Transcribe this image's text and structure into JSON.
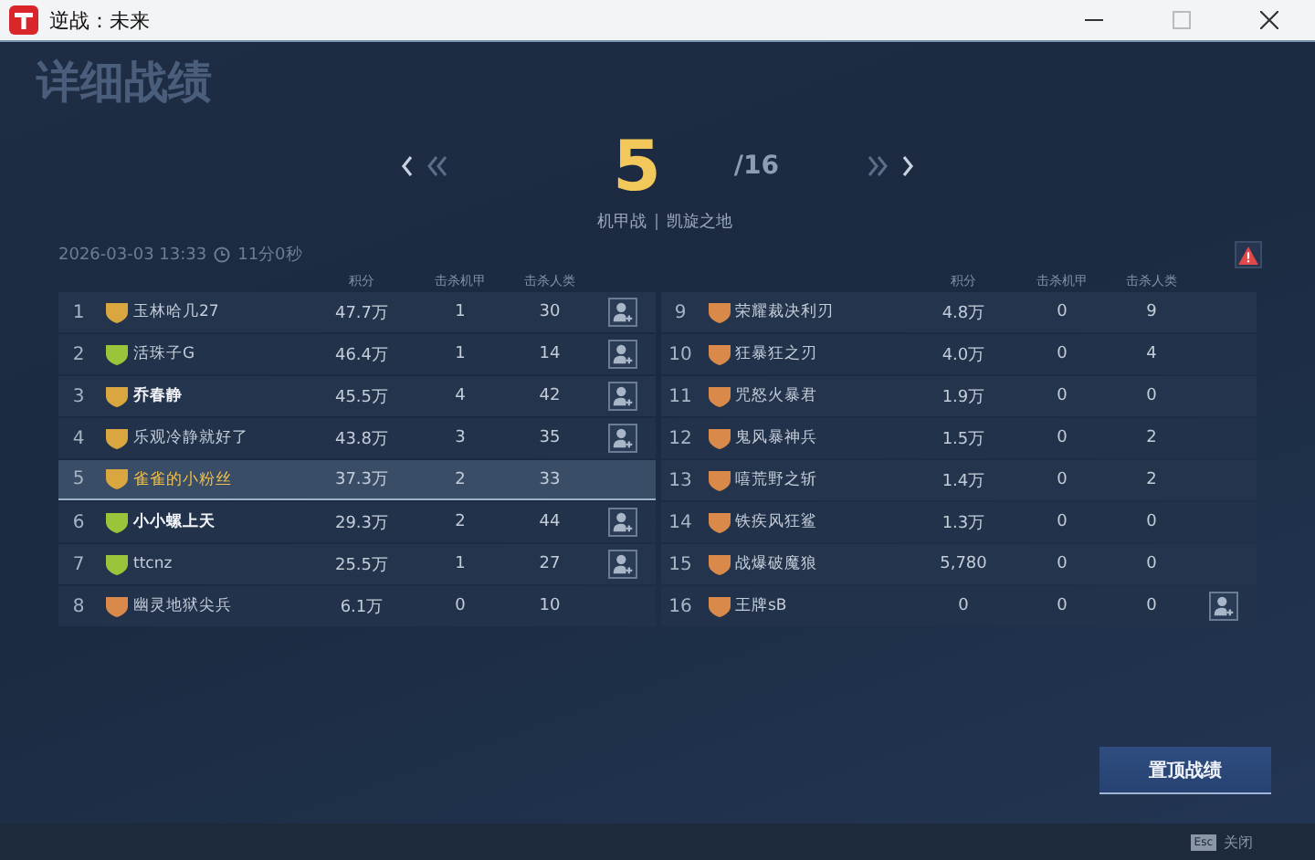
{
  "window": {
    "title": "逆战：未来"
  },
  "page_heading": "详细战绩",
  "rank": {
    "current": "5",
    "total": "/16"
  },
  "mode": "机甲战",
  "map": "凯旋之地",
  "match_time": "2026-03-03 13:33",
  "duration": "11分0秒",
  "teams": [
    {
      "columns": [
        "积分",
        "击杀机甲",
        "击杀人类"
      ],
      "rows": [
        {
          "rank": "1",
          "name": "玉林哈几27",
          "score": "47.7万",
          "mech_kills": "1",
          "human_kills": "30",
          "color": "#d9a640",
          "bold": false,
          "selected": false,
          "add_friend": true
        },
        {
          "rank": "2",
          "name": "活珠子G",
          "score": "46.4万",
          "mech_kills": "1",
          "human_kills": "14",
          "color": "#9cc43a",
          "bold": false,
          "selected": false,
          "add_friend": true
        },
        {
          "rank": "3",
          "name": "乔春静",
          "score": "45.5万",
          "mech_kills": "4",
          "human_kills": "42",
          "color": "#d9a640",
          "bold": true,
          "selected": false,
          "add_friend": true
        },
        {
          "rank": "4",
          "name": "乐观冷静就好了",
          "score": "43.8万",
          "mech_kills": "3",
          "human_kills": "35",
          "color": "#d9a640",
          "bold": false,
          "selected": false,
          "add_friend": true
        },
        {
          "rank": "5",
          "name": "雀雀的小粉丝",
          "score": "37.3万",
          "mech_kills": "2",
          "human_kills": "33",
          "color": "#d9a640",
          "bold": false,
          "selected": true,
          "add_friend": false
        },
        {
          "rank": "6",
          "name": "小小螺上天",
          "score": "29.3万",
          "mech_kills": "2",
          "human_kills": "44",
          "color": "#9cc43a",
          "bold": true,
          "selected": false,
          "add_friend": true
        },
        {
          "rank": "7",
          "name": "ttcnz",
          "score": "25.5万",
          "mech_kills": "1",
          "human_kills": "27",
          "color": "#9cc43a",
          "bold": false,
          "selected": false,
          "add_friend": true
        },
        {
          "rank": "8",
          "name": "幽灵地狱尖兵",
          "score": "6.1万",
          "mech_kills": "0",
          "human_kills": "10",
          "color": "#d98a4a",
          "bold": false,
          "selected": false,
          "add_friend": false
        }
      ]
    },
    {
      "columns": [
        "积分",
        "击杀机甲",
        "击杀人类"
      ],
      "rows": [
        {
          "rank": "9",
          "name": "荣耀裁决利刃",
          "score": "4.8万",
          "mech_kills": "0",
          "human_kills": "9",
          "color": "#d98a4a",
          "bold": false,
          "selected": false,
          "add_friend": false
        },
        {
          "rank": "10",
          "name": "狂暴狂之刃",
          "score": "4.0万",
          "mech_kills": "0",
          "human_kills": "4",
          "color": "#d98a4a",
          "bold": false,
          "selected": false,
          "add_friend": false
        },
        {
          "rank": "11",
          "name": "咒怒火暴君",
          "score": "1.9万",
          "mech_kills": "0",
          "human_kills": "0",
          "color": "#d98a4a",
          "bold": false,
          "selected": false,
          "add_friend": false
        },
        {
          "rank": "12",
          "name": "鬼风暴神兵",
          "score": "1.5万",
          "mech_kills": "0",
          "human_kills": "2",
          "color": "#d98a4a",
          "bold": false,
          "selected": false,
          "add_friend": false
        },
        {
          "rank": "13",
          "name": "嘻荒野之斩",
          "score": "1.4万",
          "mech_kills": "0",
          "human_kills": "2",
          "color": "#d98a4a",
          "bold": false,
          "selected": false,
          "add_friend": false
        },
        {
          "rank": "14",
          "name": "铁疾风狂鲨",
          "score": "1.3万",
          "mech_kills": "0",
          "human_kills": "0",
          "color": "#d98a4a",
          "bold": false,
          "selected": false,
          "add_friend": false
        },
        {
          "rank": "15",
          "name": "战爆破魔狼",
          "score": "5,780",
          "mech_kills": "0",
          "human_kills": "0",
          "color": "#d98a4a",
          "bold": false,
          "selected": false,
          "add_friend": false
        },
        {
          "rank": "16",
          "name": "王牌sB",
          "score": "0",
          "mech_kills": "0",
          "human_kills": "0",
          "color": "#d98a4a",
          "bold": false,
          "selected": false,
          "add_friend": true
        }
      ]
    }
  ],
  "pin_button": "置顶战绩",
  "footer": {
    "key": "Esc",
    "label": "关闭"
  }
}
